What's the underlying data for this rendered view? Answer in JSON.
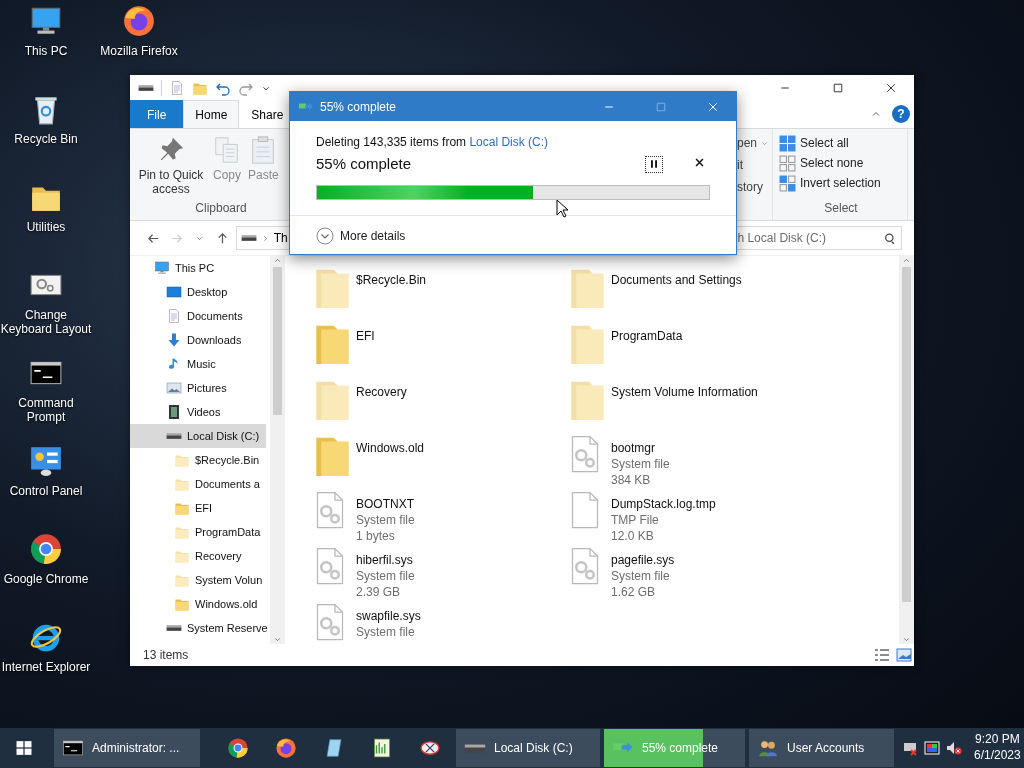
{
  "desktop_icons": [
    {
      "label": "This PC",
      "kind": "pc"
    },
    {
      "label": "Mozilla Firefox",
      "kind": "firefox"
    },
    {
      "label": "Recycle Bin",
      "kind": "recycle"
    },
    {
      "label": "Utilities",
      "kind": "folder"
    },
    {
      "label": "Change Keyboard Layout",
      "kind": "settings"
    },
    {
      "label": "Command Prompt",
      "kind": "cmd"
    },
    {
      "label": "Control Panel",
      "kind": "control"
    },
    {
      "label": "Google Chrome",
      "kind": "chrome"
    },
    {
      "label": "Internet Explorer",
      "kind": "ie"
    }
  ],
  "explorer": {
    "ribbon_tabs": [
      {
        "label": "File",
        "kind": "file",
        "selected": false
      },
      {
        "label": "Home",
        "kind": "tab",
        "selected": true
      },
      {
        "label": "Share",
        "kind": "tab",
        "selected": false
      }
    ],
    "help_button": "?",
    "clipboard": {
      "label": "Clipboard",
      "commands": [
        {
          "label": "Pin to Quick access",
          "kind": "pin",
          "disabled": false
        },
        {
          "label": "Copy",
          "kind": "copy",
          "disabled": true
        },
        {
          "label": "Paste",
          "kind": "paste",
          "disabled": true
        }
      ]
    },
    "open_group_fragments": [
      "pen",
      "it",
      "story"
    ],
    "select": {
      "label": "Select",
      "commands": [
        {
          "label": "Select all",
          "kind": "all"
        },
        {
          "label": "Select none",
          "kind": "none"
        },
        {
          "label": "Invert selection",
          "kind": "invert"
        }
      ]
    },
    "address": {
      "crumb": "Th"
    },
    "search": {
      "placeholder": "h Local Disk (C:)"
    },
    "nav_tree": [
      {
        "label": "This PC",
        "kind": "pc",
        "selected": false,
        "children": [
          {
            "label": "Desktop",
            "kind": "desktop",
            "selected": false
          },
          {
            "label": "Documents",
            "kind": "documents",
            "selected": false
          },
          {
            "label": "Downloads",
            "kind": "downloads",
            "selected": false
          },
          {
            "label": "Music",
            "kind": "music",
            "selected": false
          },
          {
            "label": "Pictures",
            "kind": "pictures",
            "selected": false
          },
          {
            "label": "Videos",
            "kind": "videos",
            "selected": false
          },
          {
            "label": "Local Disk (C:)",
            "kind": "drive",
            "selected": true,
            "children": [
              {
                "label": "$Recycle.Bin",
                "kind": "folder",
                "hidden": true,
                "selected": false
              },
              {
                "label": "Documents a",
                "kind": "folder",
                "hidden": true,
                "selected": false
              },
              {
                "label": "EFI",
                "kind": "folder",
                "hidden": false,
                "selected": false
              },
              {
                "label": "ProgramData",
                "kind": "folder",
                "hidden": true,
                "selected": false
              },
              {
                "label": "Recovery",
                "kind": "folder",
                "hidden": true,
                "selected": false
              },
              {
                "label": "System Volun",
                "kind": "folder",
                "hidden": true,
                "selected": false
              },
              {
                "label": "Windows.old",
                "kind": "folder",
                "hidden": false,
                "selected": false
              }
            ]
          },
          {
            "label": "System Reserve",
            "kind": "drive",
            "selected": false
          }
        ]
      }
    ],
    "files": [
      {
        "name": "$Recycle.Bin",
        "kind": "folder",
        "hidden": true
      },
      {
        "name": "Documents and Settings",
        "kind": "folder",
        "hidden": true
      },
      {
        "name": "EFI",
        "kind": "folder",
        "hidden": false
      },
      {
        "name": "ProgramData",
        "kind": "folder",
        "hidden": true
      },
      {
        "name": "Recovery",
        "kind": "folder",
        "hidden": true
      },
      {
        "name": "System Volume Information",
        "kind": "folder",
        "hidden": true
      },
      {
        "name": "Windows.old",
        "kind": "folder",
        "hidden": false
      },
      {
        "name": "bootmgr",
        "kind": "system",
        "type": "System file",
        "size": "384 KB",
        "hidden": false
      },
      {
        "name": "BOOTNXT",
        "kind": "system",
        "type": "System file",
        "size": "1 bytes",
        "hidden": false
      },
      {
        "name": "DumpStack.log.tmp",
        "kind": "blank",
        "type": "TMP File",
        "size": "12.0 KB",
        "hidden": false
      },
      {
        "name": "hiberfil.sys",
        "kind": "system",
        "type": "System file",
        "size": "2.39 GB",
        "hidden": false
      },
      {
        "name": "pagefile.sys",
        "kind": "system",
        "type": "System file",
        "size": "1.62 GB",
        "hidden": false
      },
      {
        "name": "swapfile.sys",
        "kind": "system",
        "type": "System file",
        "hidden": false
      }
    ],
    "status": "13 items"
  },
  "dialog": {
    "title": "55% complete",
    "message": "Deleting 143,335 items from",
    "location": "Local Disk (C:)",
    "heading": "55% complete",
    "level": 0.55,
    "more_details": "More details"
  },
  "taskbar": {
    "items": [
      {
        "kind": "cmd",
        "label": "Administrator: ..."
      },
      {
        "kind": "chrome"
      },
      {
        "kind": "firefox"
      },
      {
        "kind": "notepad"
      },
      {
        "kind": "taskmgr"
      },
      {
        "kind": "snip"
      },
      {
        "kind": "drive",
        "label": "Local Disk (C:)"
      },
      {
        "kind": "progress",
        "label": "55% complete",
        "level": 0.7
      },
      {
        "kind": "users",
        "label": "User Accounts"
      }
    ],
    "time": "9:20 PM",
    "date": "6/1/2023"
  }
}
